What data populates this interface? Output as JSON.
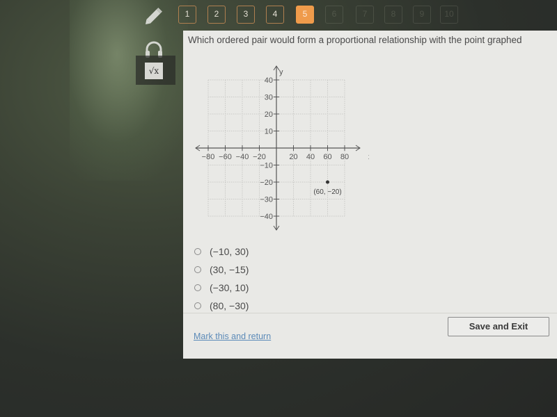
{
  "toolbar": {
    "tools": [
      {
        "name": "pencil-icon"
      },
      {
        "name": "headphones-icon"
      },
      {
        "name": "formula-icon",
        "glyph": "√x"
      }
    ]
  },
  "question_nav": {
    "items": [
      {
        "label": "1",
        "state": "answered"
      },
      {
        "label": "2",
        "state": "answered"
      },
      {
        "label": "3",
        "state": "answered"
      },
      {
        "label": "4",
        "state": "answered"
      },
      {
        "label": "5",
        "state": "current"
      },
      {
        "label": "6",
        "state": "unvisited"
      },
      {
        "label": "7",
        "state": "unvisited"
      },
      {
        "label": "8",
        "state": "unvisited"
      },
      {
        "label": "9",
        "state": "unvisited"
      },
      {
        "label": "10",
        "state": "unvisited"
      }
    ],
    "accent_color": "#ef9b4b"
  },
  "question": {
    "text": "Which ordered pair would form a proportional relationship with the point graphed"
  },
  "chart_data": {
    "type": "scatter",
    "title": "",
    "xlabel": "x",
    "ylabel": "y",
    "xlim": [
      -80,
      80
    ],
    "ylim": [
      -40,
      40
    ],
    "grid": true,
    "x_ticks": [
      -80,
      -60,
      -40,
      -20,
      20,
      40,
      60,
      80
    ],
    "y_ticks": [
      40,
      30,
      20,
      10,
      -10,
      -20,
      -30,
      -40
    ],
    "x_tick_labels": [
      "−80",
      "−60",
      "−40",
      "−20",
      "20",
      "40",
      "60",
      "80"
    ],
    "y_tick_labels": [
      "40",
      "30",
      "20",
      "10",
      "−10",
      "−20",
      "−30",
      "−40"
    ],
    "points": [
      {
        "x": 60,
        "y": -20,
        "label": "(60, −20)"
      }
    ]
  },
  "choices": [
    {
      "label": "(−10, 30)",
      "selected": false
    },
    {
      "label": "(30, −15)",
      "selected": false
    },
    {
      "label": "(−30, 10)",
      "selected": false
    },
    {
      "label": "(80, −30)",
      "selected": false
    }
  ],
  "footer": {
    "mark_link": "Mark this and return",
    "save_button": "Save and Exit"
  }
}
